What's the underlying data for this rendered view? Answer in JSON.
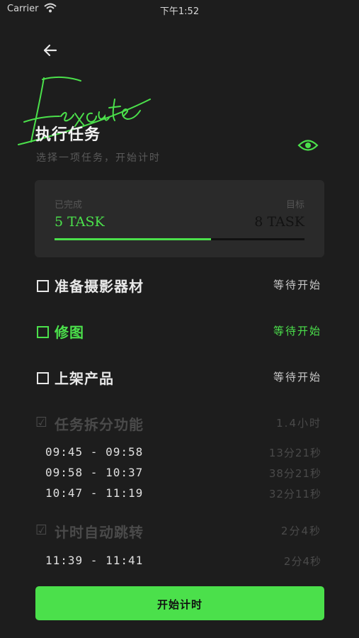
{
  "status_bar": {
    "carrier": "Carrier",
    "time": "下午1:52"
  },
  "header": {
    "script_word": "Execute",
    "title": "执行任务",
    "subtitle": "选择一项任务，开始计时"
  },
  "progress": {
    "done_label": "已完成",
    "done_value": "5 TASK",
    "goal_label": "目标",
    "goal_value": "8 TASK",
    "fraction": 0.625
  },
  "tasks": [
    {
      "name": "准备摄影器材",
      "state": "等待开始"
    },
    {
      "name": "修图",
      "state": "等待开始"
    },
    {
      "name": "上架产品",
      "state": "等待开始"
    }
  ],
  "completed": [
    {
      "name": "任务拆分功能",
      "total": "1.4小时",
      "segments": [
        {
          "range": "09:45 - 09:58",
          "duration": "13分21秒"
        },
        {
          "range": "09:58 - 10:37",
          "duration": "38分21秒"
        },
        {
          "range": "10:47 - 11:19",
          "duration": "32分11秒"
        }
      ]
    },
    {
      "name": "计时自动跳转",
      "total": "2分4秒",
      "segments": [
        {
          "range": "11:39 - 11:41",
          "duration": "2分4秒"
        }
      ]
    }
  ],
  "start_button": {
    "label": "开始计时"
  },
  "colors": {
    "accent": "#4be04b",
    "background": "#1d1d1d",
    "card": "#2a2a2a"
  }
}
